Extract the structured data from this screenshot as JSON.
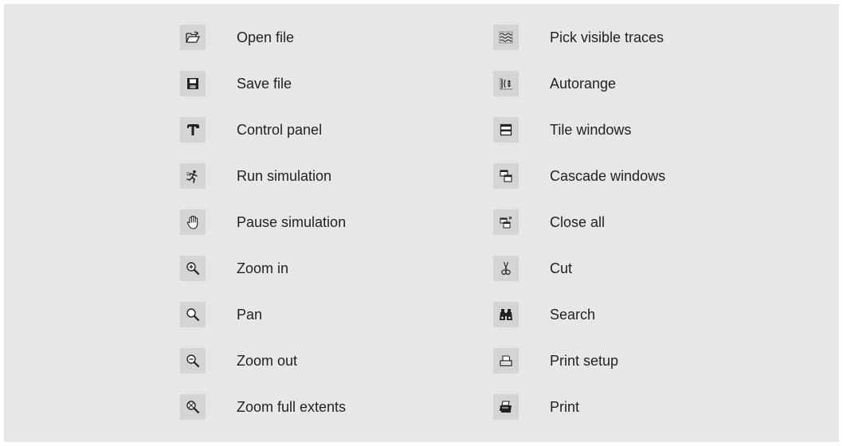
{
  "left_column": [
    {
      "label": "Open file",
      "icon": "open-folder-icon"
    },
    {
      "label": "Save file",
      "icon": "floppy-disk-icon"
    },
    {
      "label": "Control panel",
      "icon": "hammer-icon"
    },
    {
      "label": "Run simulation",
      "icon": "running-man-icon"
    },
    {
      "label": "Pause simulation",
      "icon": "hand-icon"
    },
    {
      "label": "Zoom in",
      "icon": "zoom-in-icon"
    },
    {
      "label": "Pan",
      "icon": "magnifier-icon"
    },
    {
      "label": "Zoom out",
      "icon": "zoom-out-icon"
    },
    {
      "label": "Zoom full extents",
      "icon": "zoom-full-extents-icon"
    }
  ],
  "right_column": [
    {
      "label": "Pick visible traces",
      "icon": "traces-icon"
    },
    {
      "label": "Autorange",
      "icon": "autorange-icon"
    },
    {
      "label": "Tile windows",
      "icon": "tile-windows-icon"
    },
    {
      "label": "Cascade windows",
      "icon": "cascade-windows-icon"
    },
    {
      "label": "Close all",
      "icon": "close-all-windows-icon"
    },
    {
      "label": "Cut",
      "icon": "scissors-icon"
    },
    {
      "label": "Search",
      "icon": "binoculars-icon"
    },
    {
      "label": "Print setup",
      "icon": "print-setup-icon"
    },
    {
      "label": "Print",
      "icon": "printer-icon"
    }
  ]
}
